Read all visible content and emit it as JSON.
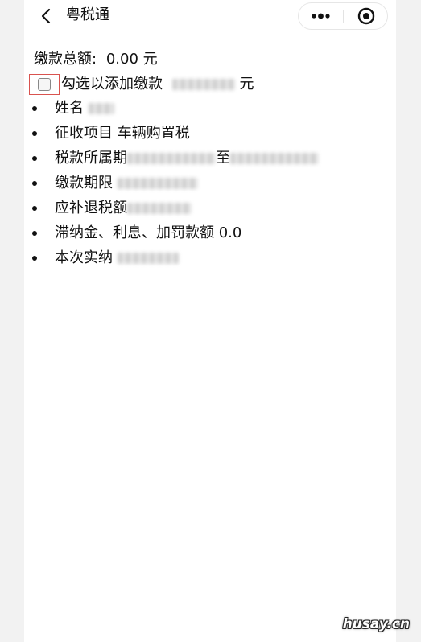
{
  "nav": {
    "title": "粤税通",
    "back_icon": "chevron-left-icon",
    "more_icon": "more-dots-icon",
    "close_icon": "target-close-icon"
  },
  "summary": {
    "total_label": "缴款总额:",
    "total_value": "0.00",
    "currency": "元"
  },
  "checkbox": {
    "label": "勾选以添加缴款",
    "suffix": "元",
    "checked": false
  },
  "items": [
    {
      "label": "姓名"
    },
    {
      "label": "征收项目",
      "value": "车辆购置税"
    },
    {
      "label": "税款所属期",
      "middle": "至"
    },
    {
      "label": "缴款期限"
    },
    {
      "label": "应补退税额"
    },
    {
      "label": "滞纳金、利息、加罚款额",
      "value": "0.0"
    },
    {
      "label": "本次实纳"
    }
  ],
  "watermark": "husay.cn"
}
